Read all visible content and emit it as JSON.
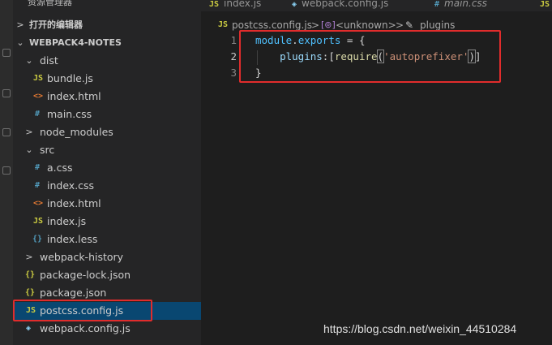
{
  "sidebar": {
    "title": "资源管理器",
    "more": "···",
    "open_editors": "打开的编辑器",
    "project": "WEBPACK4-NOTES",
    "items": [
      {
        "label": "dist",
        "icon": "chevron-down"
      },
      {
        "label": "bundle.js",
        "icon": "JS"
      },
      {
        "label": "index.html",
        "icon": "<>"
      },
      {
        "label": "main.css",
        "icon": "#"
      },
      {
        "label": "node_modules",
        "icon": "chevron-right"
      },
      {
        "label": "src",
        "icon": "chevron-down"
      },
      {
        "label": "a.css",
        "icon": "#"
      },
      {
        "label": "index.css",
        "icon": "#"
      },
      {
        "label": "index.html",
        "icon": "<>"
      },
      {
        "label": "index.js",
        "icon": "JS"
      },
      {
        "label": "index.less",
        "icon": "{}"
      },
      {
        "label": "webpack-history",
        "icon": "chevron-right"
      },
      {
        "label": "package-lock.json",
        "icon": "{}"
      },
      {
        "label": "package.json",
        "icon": "{}"
      },
      {
        "label": "postcss.config.js",
        "icon": "JS",
        "selected": true
      },
      {
        "label": "webpack.config.js",
        "icon": "webpack"
      }
    ]
  },
  "tabs": [
    {
      "label": "index.js",
      "icon": "JS"
    },
    {
      "label": "webpack.config.js",
      "icon": "webpack"
    },
    {
      "label": "main.css",
      "icon": "#"
    },
    {
      "label": "",
      "icon": "JS"
    }
  ],
  "breadcrumb": {
    "file_icon": "JS",
    "file": "postcss.config.js",
    "sep": ">",
    "unknown": "<unknown>",
    "symbol": "plugins"
  },
  "editor": {
    "lines": [
      {
        "num": "1"
      },
      {
        "num": "2"
      },
      {
        "num": "3"
      }
    ],
    "code": {
      "l1_module": "module",
      "l1_dot": ".",
      "l1_exports": "exports",
      "l1_rest": " = {",
      "l2_indent": "    ",
      "l2_plugins": "plugins",
      "l2_colon": ":[",
      "l2_require": "require",
      "l2_open": "(",
      "l2_str": "'autoprefixer'",
      "l2_close": ")",
      "l2_end": "]",
      "l3": "}"
    }
  },
  "watermark": "https://blog.csdn.net/weixin_44510284",
  "colors": {
    "highlight_box": "#e12c2c",
    "selection": "#094771",
    "js_icon": "#cbcb41",
    "css_icon": "#519aba",
    "html_icon": "#e37933"
  }
}
